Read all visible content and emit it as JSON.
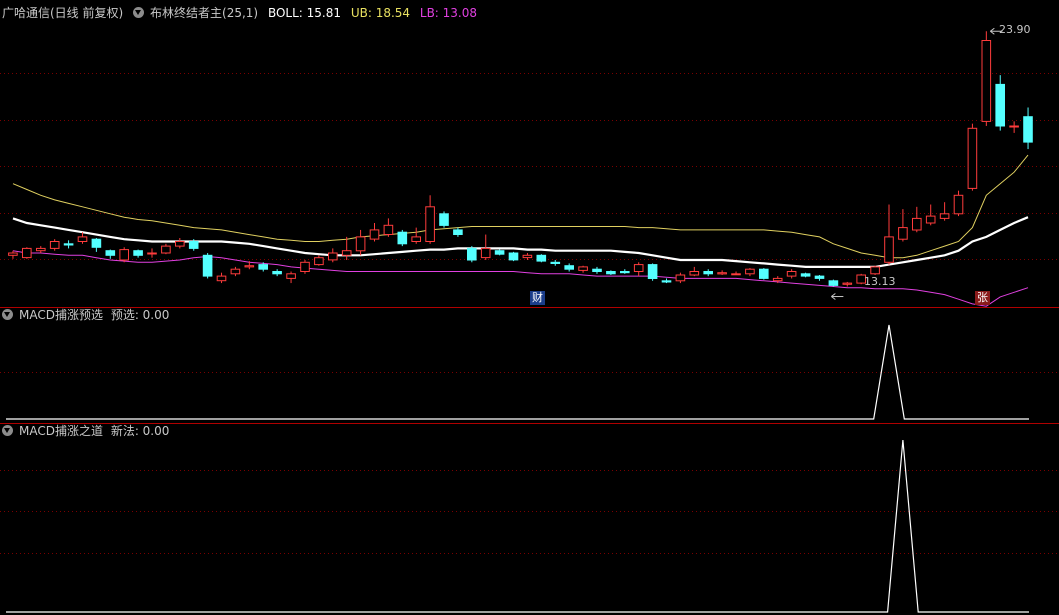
{
  "header": {
    "stock": "广哈通信(日线 前复权)",
    "indicator": "布林终结者主(25,1)",
    "boll": "BOLL: 15.81",
    "ub": "UB: 18.54",
    "lb": "LB: 13.08"
  },
  "panel2": {
    "name": "MACD捕涨预选",
    "value": "预选: 0.00"
  },
  "panel3": {
    "name": "MACD捕涨之道",
    "value": "新法: 0.00"
  },
  "annotations": {
    "high": "23.90",
    "low": "13.13",
    "marker_cai": "财",
    "marker_zhang": "张"
  },
  "colors": {
    "up": "#ff3c3c",
    "down": "#54ffff",
    "mid": "#ffffff",
    "ub": "#e0d060",
    "lb": "#e040e0",
    "grid": "#7a0000",
    "border": "#b00000",
    "signal": "#ffffff"
  },
  "chart_data": [
    {
      "type": "candlestick",
      "title": "广哈通信(日线 前复权)",
      "ylim": [
        12.7,
        24.3
      ],
      "candles": [
        [
          14.2,
          14.3,
          14.05,
          14.4
        ],
        [
          14.1,
          14.5,
          14.05,
          14.55
        ],
        [
          14.4,
          14.5,
          14.3,
          14.6
        ],
        [
          14.5,
          14.8,
          14.4,
          14.9
        ],
        [
          14.7,
          14.65,
          14.5,
          14.85
        ],
        [
          14.8,
          15.0,
          14.7,
          15.2
        ],
        [
          14.9,
          14.55,
          14.35,
          14.95
        ],
        [
          14.4,
          14.2,
          14.05,
          14.45
        ],
        [
          14.0,
          14.45,
          13.9,
          14.55
        ],
        [
          14.4,
          14.2,
          14.1,
          14.45
        ],
        [
          14.3,
          14.3,
          14.1,
          14.5
        ],
        [
          14.3,
          14.6,
          14.25,
          14.7
        ],
        [
          14.6,
          14.8,
          14.5,
          14.95
        ],
        [
          14.8,
          14.5,
          14.4,
          14.9
        ],
        [
          14.2,
          13.3,
          13.2,
          14.3
        ],
        [
          13.1,
          13.3,
          13.0,
          13.45
        ],
        [
          13.4,
          13.6,
          13.3,
          13.7
        ],
        [
          13.7,
          13.75,
          13.6,
          13.95
        ],
        [
          13.8,
          13.6,
          13.5,
          13.9
        ],
        [
          13.5,
          13.4,
          13.3,
          13.6
        ],
        [
          13.2,
          13.4,
          13.0,
          13.5
        ],
        [
          13.5,
          13.9,
          13.4,
          14.0
        ],
        [
          13.8,
          14.1,
          13.75,
          14.2
        ],
        [
          14.0,
          14.3,
          13.9,
          14.5
        ],
        [
          14.2,
          14.4,
          14.0,
          15.0
        ],
        [
          14.4,
          15.0,
          14.2,
          15.3
        ],
        [
          14.9,
          15.3,
          14.8,
          15.6
        ],
        [
          15.1,
          15.5,
          15.0,
          15.8
        ],
        [
          15.2,
          14.7,
          14.6,
          15.3
        ],
        [
          14.8,
          15.0,
          14.7,
          15.4
        ],
        [
          14.8,
          16.3,
          14.7,
          16.8
        ],
        [
          16.0,
          15.5,
          15.4,
          16.1
        ],
        [
          15.3,
          15.1,
          15.0,
          15.4
        ],
        [
          14.5,
          14.0,
          13.9,
          14.6
        ],
        [
          14.1,
          14.5,
          14.0,
          15.1
        ],
        [
          14.4,
          14.25,
          14.2,
          14.45
        ],
        [
          14.3,
          14.0,
          13.95,
          14.35
        ],
        [
          14.1,
          14.2,
          14.0,
          14.3
        ],
        [
          14.2,
          13.95,
          13.9,
          14.25
        ],
        [
          13.9,
          13.85,
          13.75,
          14.0
        ],
        [
          13.75,
          13.6,
          13.5,
          13.85
        ],
        [
          13.55,
          13.7,
          13.45,
          13.75
        ],
        [
          13.6,
          13.5,
          13.4,
          13.7
        ],
        [
          13.5,
          13.4,
          13.35,
          13.55
        ],
        [
          13.5,
          13.45,
          13.4,
          13.6
        ],
        [
          13.5,
          13.8,
          13.3,
          13.9
        ],
        [
          13.8,
          13.2,
          13.1,
          13.85
        ],
        [
          13.1,
          13.05,
          13.0,
          13.2
        ],
        [
          13.1,
          13.35,
          13.0,
          13.45
        ],
        [
          13.35,
          13.5,
          13.3,
          13.7
        ],
        [
          13.5,
          13.4,
          13.3,
          13.6
        ],
        [
          13.4,
          13.45,
          13.35,
          13.55
        ],
        [
          13.4,
          13.4,
          13.35,
          13.5
        ],
        [
          13.4,
          13.6,
          13.3,
          13.65
        ],
        [
          13.6,
          13.2,
          13.15,
          13.65
        ],
        [
          13.1,
          13.2,
          13.0,
          13.3
        ],
        [
          13.3,
          13.5,
          13.2,
          13.6
        ],
        [
          13.4,
          13.3,
          13.25,
          13.45
        ],
        [
          13.3,
          13.2,
          13.1,
          13.35
        ],
        [
          13.1,
          12.9,
          12.85,
          13.15
        ],
        [
          12.95,
          13.0,
          12.85,
          13.05
        ],
        [
          13.0,
          13.35,
          12.95,
          13.4
        ],
        [
          13.4,
          13.7,
          13.35,
          13.75
        ],
        [
          13.9,
          15.0,
          13.8,
          16.4
        ],
        [
          14.9,
          15.4,
          14.8,
          16.2
        ],
        [
          15.3,
          15.8,
          15.2,
          16.3
        ],
        [
          15.6,
          15.9,
          15.5,
          16.4
        ],
        [
          15.8,
          16.0,
          15.7,
          16.5
        ],
        [
          16.0,
          16.8,
          15.9,
          17.0
        ],
        [
          17.1,
          19.7,
          17.0,
          19.9
        ],
        [
          20.0,
          23.5,
          19.8,
          23.9
        ],
        [
          21.6,
          19.8,
          19.6,
          22.0
        ],
        [
          19.8,
          19.8,
          19.5,
          20.0
        ],
        [
          20.2,
          19.1,
          18.8,
          20.6
        ]
      ],
      "boll_mid": [
        15.8,
        15.6,
        15.5,
        15.4,
        15.3,
        15.2,
        15.1,
        15.0,
        14.9,
        14.85,
        14.8,
        14.8,
        14.8,
        14.8,
        14.8,
        14.8,
        14.75,
        14.7,
        14.6,
        14.5,
        14.4,
        14.3,
        14.25,
        14.2,
        14.2,
        14.2,
        14.25,
        14.3,
        14.35,
        14.4,
        14.45,
        14.45,
        14.5,
        14.5,
        14.5,
        14.5,
        14.5,
        14.45,
        14.45,
        14.4,
        14.4,
        14.4,
        14.4,
        14.4,
        14.35,
        14.3,
        14.2,
        14.1,
        14.0,
        14.0,
        14.0,
        14.0,
        13.95,
        13.9,
        13.85,
        13.8,
        13.75,
        13.7,
        13.7,
        13.7,
        13.7,
        13.7,
        13.7,
        13.8,
        13.9,
        14.0,
        14.1,
        14.2,
        14.4,
        14.8,
        15.0,
        15.3,
        15.6,
        15.85
      ],
      "boll_ub": [
        17.3,
        17.05,
        16.8,
        16.6,
        16.45,
        16.3,
        16.15,
        16.0,
        15.85,
        15.75,
        15.7,
        15.6,
        15.5,
        15.4,
        15.35,
        15.3,
        15.2,
        15.1,
        15.0,
        14.9,
        14.85,
        14.8,
        14.8,
        14.85,
        14.9,
        15.0,
        15.05,
        15.1,
        15.15,
        15.2,
        15.3,
        15.35,
        15.4,
        15.45,
        15.45,
        15.45,
        15.45,
        15.45,
        15.45,
        15.45,
        15.45,
        15.45,
        15.45,
        15.45,
        15.45,
        15.4,
        15.4,
        15.35,
        15.3,
        15.3,
        15.3,
        15.3,
        15.3,
        15.3,
        15.3,
        15.25,
        15.2,
        15.1,
        15.0,
        14.7,
        14.5,
        14.3,
        14.2,
        14.1,
        14.1,
        14.2,
        14.4,
        14.6,
        14.8,
        15.4,
        16.8,
        17.3,
        17.8,
        18.54
      ],
      "boll_lb": [
        14.4,
        14.3,
        14.3,
        14.25,
        14.2,
        14.2,
        14.1,
        14.0,
        13.95,
        13.9,
        13.9,
        13.95,
        14.0,
        14.1,
        14.15,
        14.1,
        14.0,
        13.9,
        13.85,
        13.8,
        13.7,
        13.65,
        13.6,
        13.55,
        13.5,
        13.5,
        13.5,
        13.5,
        13.5,
        13.5,
        13.5,
        13.5,
        13.5,
        13.5,
        13.5,
        13.5,
        13.5,
        13.45,
        13.4,
        13.4,
        13.4,
        13.35,
        13.3,
        13.3,
        13.3,
        13.3,
        13.3,
        13.25,
        13.2,
        13.2,
        13.2,
        13.2,
        13.2,
        13.15,
        13.1,
        13.05,
        13.0,
        12.95,
        12.9,
        12.85,
        12.8,
        12.8,
        12.75,
        12.75,
        12.75,
        12.7,
        12.6,
        12.5,
        12.3,
        12.1,
        12.0,
        12.4,
        12.6,
        12.8
      ]
    },
    {
      "type": "line",
      "title": "MACD捕涨预选",
      "ylim": [
        0,
        1
      ],
      "spike_index": 63,
      "values_note": "zero except single spike to 1"
    },
    {
      "type": "line",
      "title": "MACD捕涨之道",
      "ylim": [
        0,
        1
      ],
      "spike_index": 64
    }
  ]
}
